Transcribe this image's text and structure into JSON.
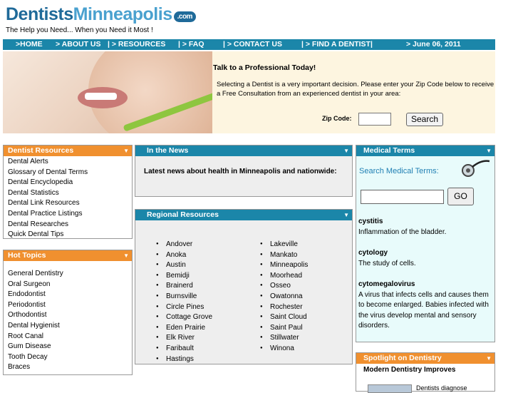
{
  "header": {
    "logo_part1": "Dentists",
    "logo_part2": "Minneapolis",
    "logo_badge": ".com",
    "tagline": "The Help you Need... When you Need it Most !"
  },
  "nav": {
    "items": [
      ">HOME",
      "> ABOUT US",
      "| > RESOURCES",
      "| > FAQ",
      "| > CONTACT US",
      "| > FIND A DENTIST|"
    ],
    "date": "> June 06, 2011"
  },
  "hero": {
    "title": "Talk to a Professional Today!",
    "text": "Selecting a Dentist is a very important decision. Please enter your Zip Code below to receive a Free Consultation from an experienced dentist in your area:",
    "zip_label": "Zip Code:",
    "zip_value": "",
    "search_label": "Search"
  },
  "dentist_resources": {
    "title": "Dentist Resources",
    "items": [
      "Dental Alerts",
      "Glossary of Dental Terms",
      "Dental Encyclopedia",
      "Dental Statistics",
      "Dental Link Resources",
      "Dental Practice Listings",
      "Dental Researches",
      "Quick Dental Tips"
    ]
  },
  "hot_topics": {
    "title": "Hot Topics",
    "items": [
      "General Dentistry",
      "Oral Surgeon",
      "Endodontist",
      "Periodontist",
      "Orthodontist",
      "Dental Hygienist",
      "Root Canal",
      "Gum Disease",
      "Tooth Decay",
      "Braces"
    ]
  },
  "news": {
    "title": "In the News",
    "text": "Latest news about health in Minneapolis and nationwide:"
  },
  "regional": {
    "title": "Regional Resources",
    "col1": [
      "Andover",
      "Anoka",
      "Austin",
      "Bemidji",
      "Brainerd",
      "Burnsville",
      "Circle Pines",
      "Cottage Grove",
      "Eden Prairie",
      "Elk River",
      "Faribault",
      "Hastings"
    ],
    "col2": [
      "Lakeville",
      "Mankato",
      "Minneapolis",
      "Moorhead",
      "Osseo",
      "Owatonna",
      "Rochester",
      "Saint Cloud",
      "Saint Paul",
      "Stillwater",
      "Winona"
    ]
  },
  "medical_terms": {
    "title": "Medical Terms",
    "search_label": "Search Medical Terms:",
    "input_value": "",
    "go_label": "GO",
    "terms": [
      {
        "term": "cystitis",
        "def": "Inflammation of the bladder."
      },
      {
        "term": "cytology",
        "def": "The study of cells."
      },
      {
        "term": "cytomegalovirus",
        "def": "A virus that infects cells and causes them to become enlarged. Babies infected with the virus develop mental and sensory disorders."
      }
    ]
  },
  "spotlight": {
    "title": "Spotlight on Dentistry",
    "headline": "Modern Dentistry Improves",
    "snippet": "Dentists diagnose"
  },
  "colors": {
    "nav": "#1b86a9",
    "orange": "#f0902f",
    "hero_bg": "#fdf5e0",
    "terms_bg": "#e8fbfb"
  }
}
